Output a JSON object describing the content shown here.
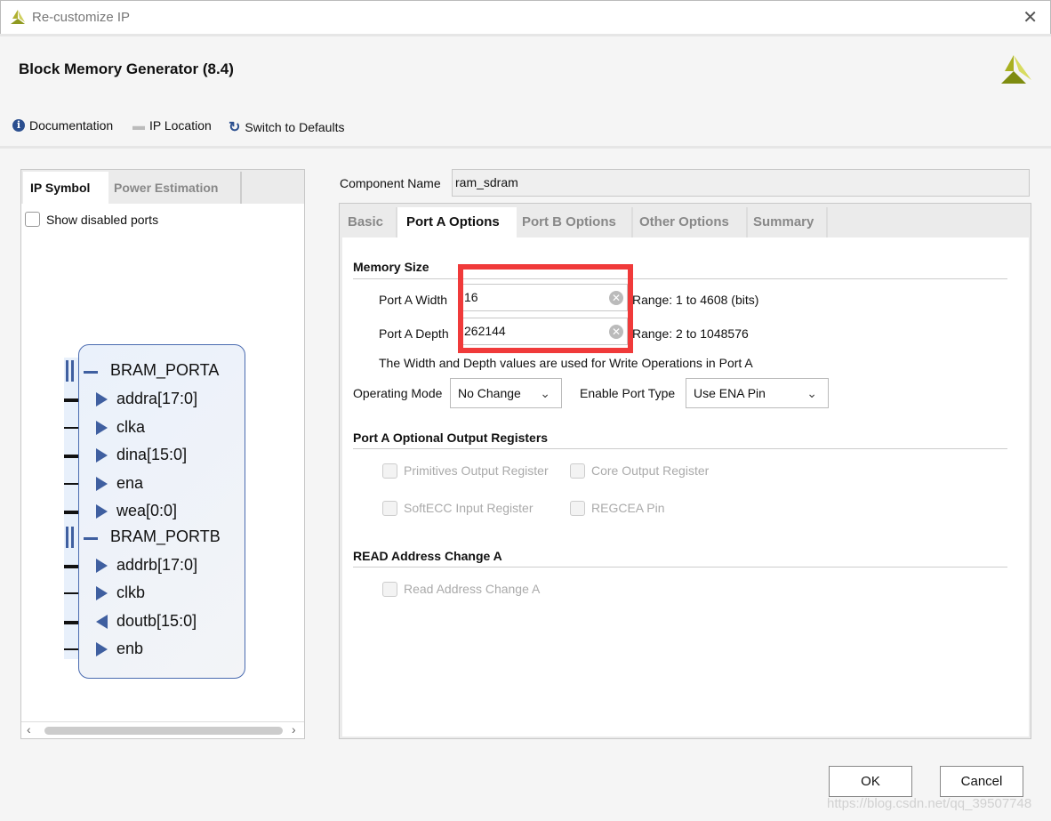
{
  "window": {
    "title": "Re-customize IP",
    "close_icon": "close-icon"
  },
  "header": {
    "title": "Block Memory Generator (8.4)"
  },
  "toolbar": {
    "documentation": "Documentation",
    "ip_location": "IP Location",
    "switch_defaults": "Switch to Defaults"
  },
  "left_panel": {
    "tabs": [
      {
        "label": "IP Symbol",
        "active": true
      },
      {
        "label": "Power Estimation",
        "active": false
      }
    ],
    "show_disabled_ports": "Show disabled ports",
    "symbol": {
      "porta": "BRAM_PORTA",
      "porta_pins": [
        {
          "name": "addra[17:0]",
          "dir": "in",
          "bus": true
        },
        {
          "name": "clka",
          "dir": "in",
          "bus": false
        },
        {
          "name": "dina[15:0]",
          "dir": "in",
          "bus": true
        },
        {
          "name": "ena",
          "dir": "in",
          "bus": false
        },
        {
          "name": "wea[0:0]",
          "dir": "in",
          "bus": true
        }
      ],
      "portb": "BRAM_PORTB",
      "portb_pins": [
        {
          "name": "addrb[17:0]",
          "dir": "in",
          "bus": true
        },
        {
          "name": "clkb",
          "dir": "in",
          "bus": false
        },
        {
          "name": "doutb[15:0]",
          "dir": "out",
          "bus": true
        },
        {
          "name": "enb",
          "dir": "in",
          "bus": false
        }
      ]
    }
  },
  "component": {
    "label": "Component Name",
    "value": "ram_sdram"
  },
  "tabs": [
    {
      "label": "Basic"
    },
    {
      "label": "Port A Options",
      "active": true
    },
    {
      "label": "Port B Options"
    },
    {
      "label": "Other Options"
    },
    {
      "label": "Summary"
    }
  ],
  "memory_size": {
    "title": "Memory Size",
    "width_label": "Port A Width",
    "width_value": "16",
    "width_range": "Range: 1 to 4608 (bits)",
    "depth_label": "Port A Depth",
    "depth_value": "262144",
    "depth_range": "Range: 2 to 1048576",
    "note": "The Width and Depth values are used for Write Operations in Port A"
  },
  "operating_mode": {
    "label": "Operating Mode",
    "value": "No Change"
  },
  "enable_port_type": {
    "label": "Enable Port Type",
    "value": "Use ENA Pin"
  },
  "optional_regs": {
    "title": "Port A Optional Output Registers",
    "items": [
      "Primitives Output Register",
      "Core Output Register",
      "SoftECC Input Register",
      "REGCEA Pin"
    ]
  },
  "read_addr": {
    "title": "READ Address Change A",
    "item": "Read Address Change A"
  },
  "buttons": {
    "ok": "OK",
    "cancel": "Cancel"
  },
  "highlight_color": "#f03a3a",
  "watermark": "https://blog.csdn.net/qq_39507748"
}
